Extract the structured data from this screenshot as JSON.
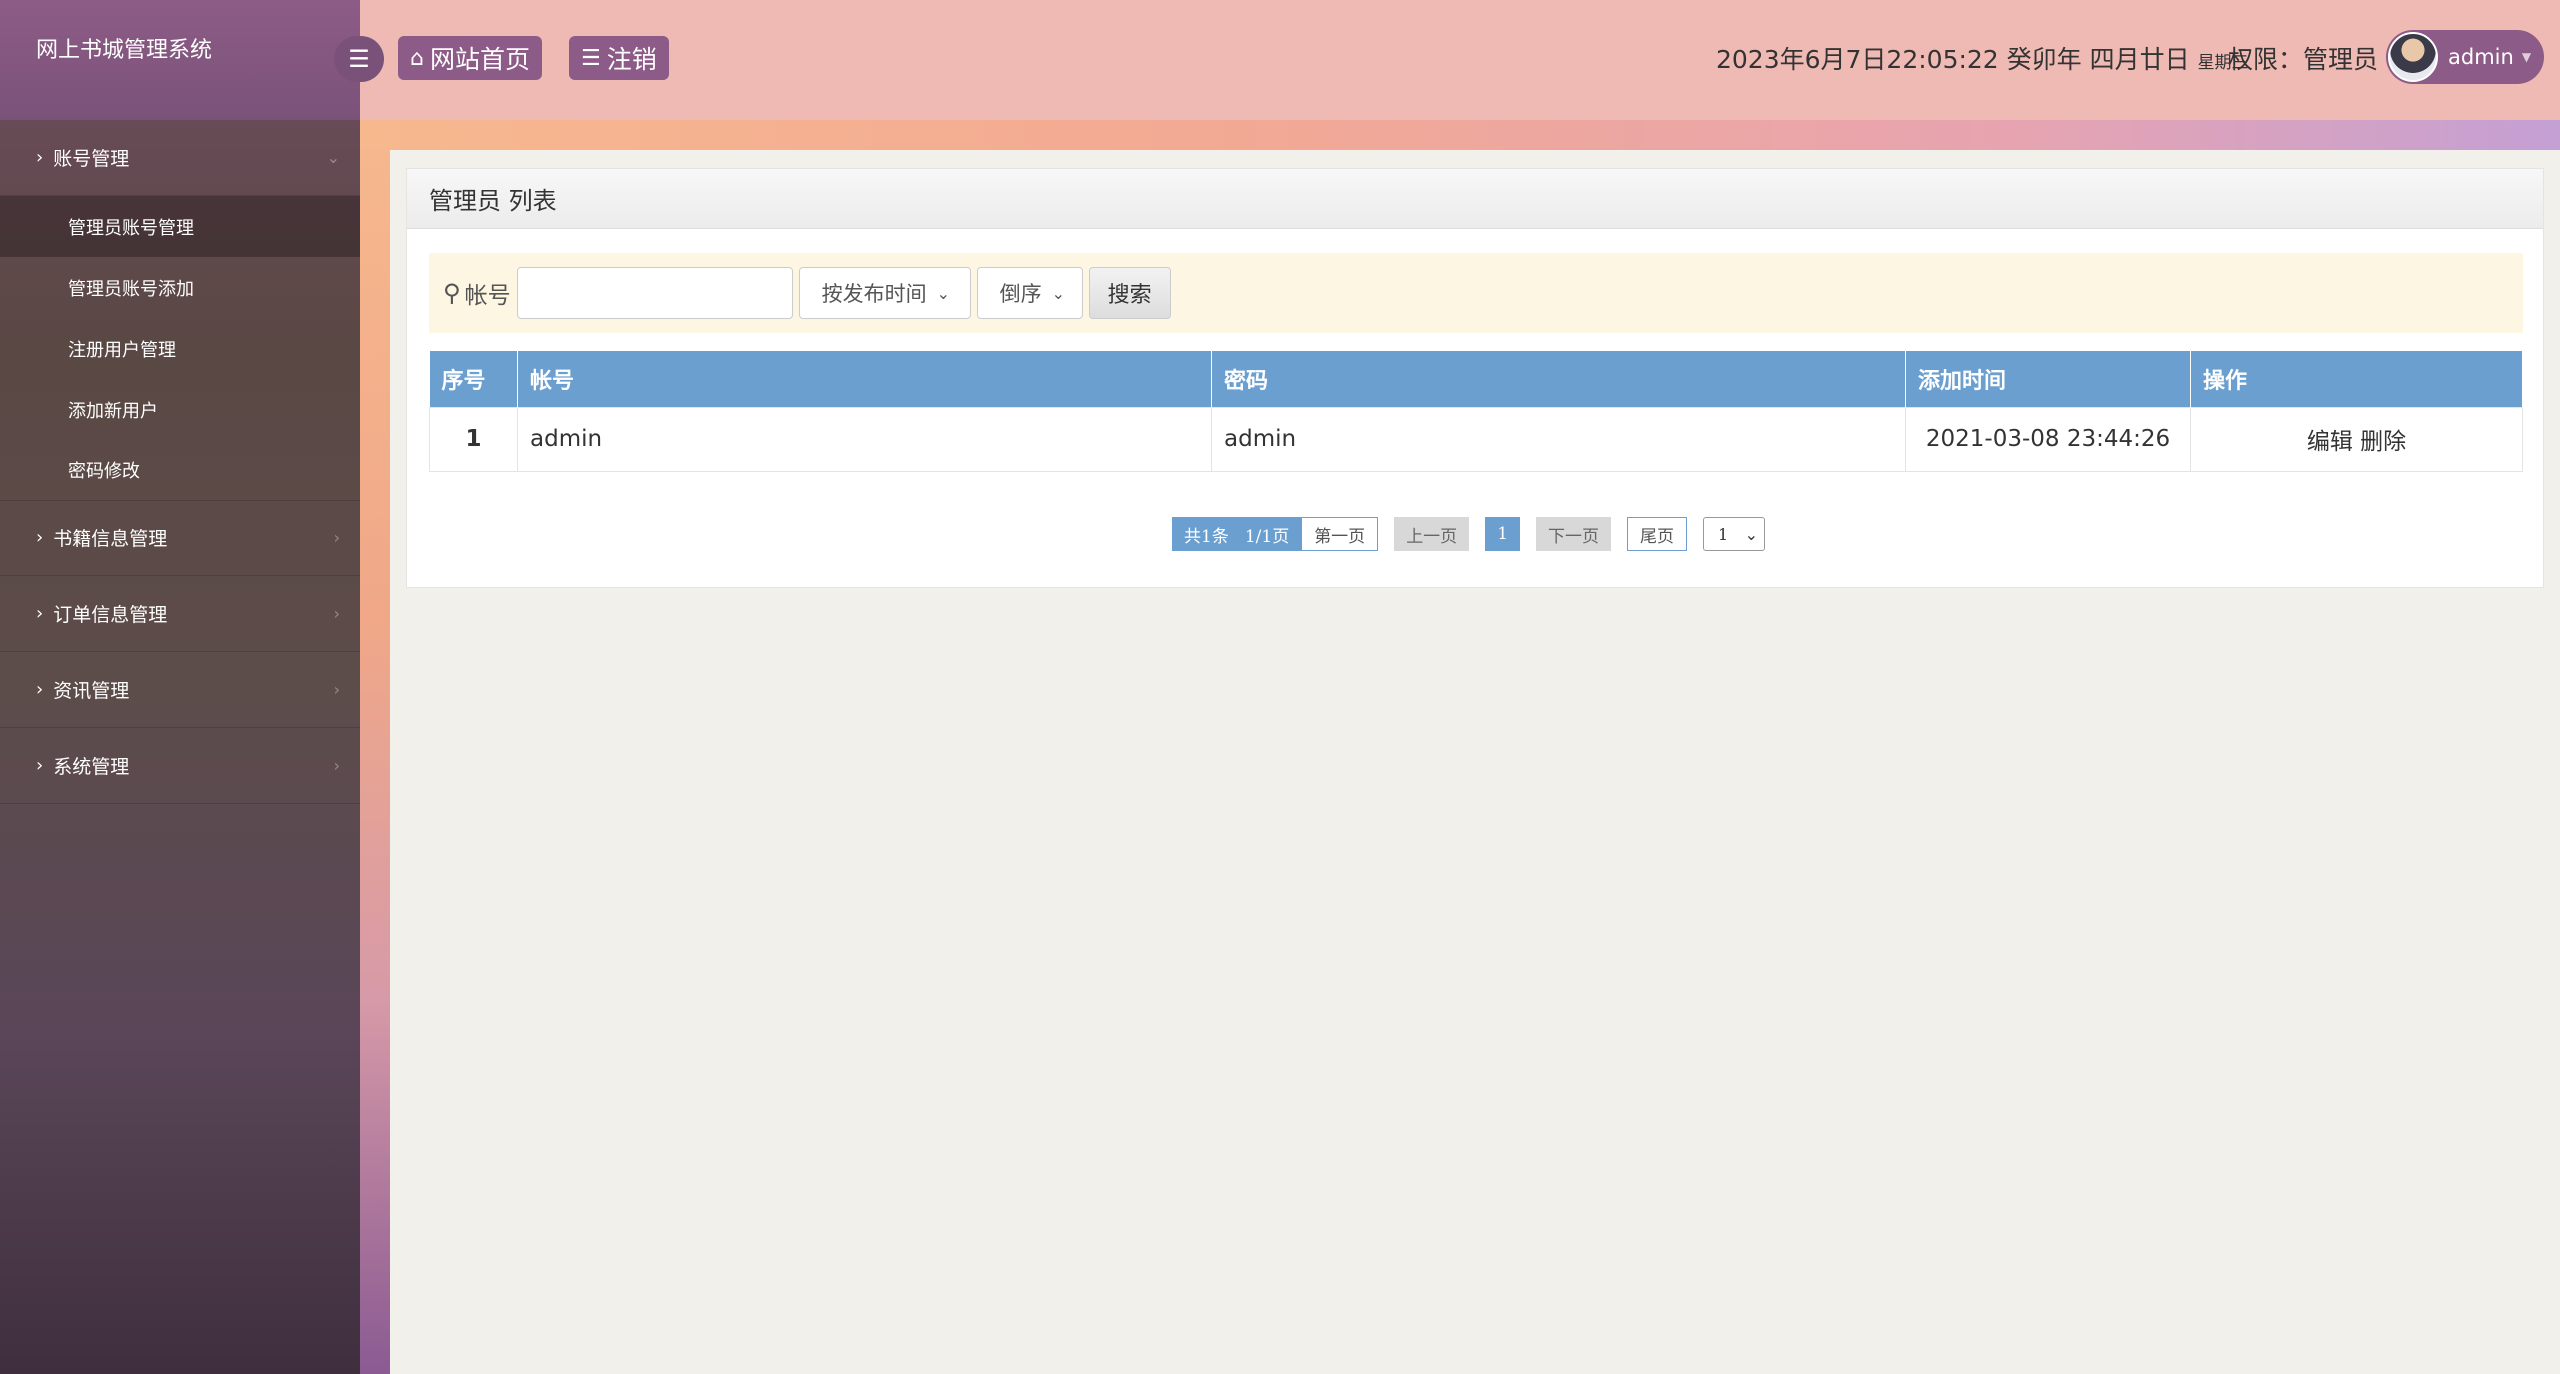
{
  "app": {
    "title": "网上书城管理系统"
  },
  "topbar": {
    "home_label": "网站首页",
    "logout_label": "注销",
    "datetime": "2023年6月7日22:05:22 癸卯年 四月廿日",
    "weekday": "星期三",
    "role": "权限：管理员",
    "username": "admin"
  },
  "sidebar": {
    "groups": [
      {
        "label": "账号管理",
        "expanded": true,
        "items": [
          {
            "label": "管理员账号管理",
            "active": true
          },
          {
            "label": "管理员账号添加"
          },
          {
            "label": "注册用户管理"
          },
          {
            "label": "添加新用户"
          },
          {
            "label": "密码修改"
          }
        ]
      },
      {
        "label": "书籍信息管理"
      },
      {
        "label": "订单信息管理"
      },
      {
        "label": "资讯管理"
      },
      {
        "label": "系统管理"
      }
    ]
  },
  "panel": {
    "title": "管理员 列表",
    "search": {
      "field_label": "帐号",
      "field_value": "",
      "sort_select": "按发布时间",
      "order_select": "倒序",
      "button": "搜索"
    },
    "table": {
      "headers": [
        "序号",
        "帐号",
        "密码",
        "添加时间",
        "操作"
      ],
      "rows": [
        {
          "index": "1",
          "account": "admin",
          "password": "admin",
          "time": "2021-03-08 23:44:26",
          "edit": "编辑",
          "delete": "删除"
        }
      ]
    },
    "pagination": {
      "total": "共1条",
      "pages": "1/1页",
      "first": "第一页",
      "prev": "上一页",
      "current": "1",
      "next": "下一页",
      "last": "尾页",
      "jump": "1"
    }
  },
  "colors": {
    "sidebar": "#5c4c4a",
    "brand": "#8d5c86",
    "topbar": "#efbab4",
    "accent": "#6a9fd0"
  }
}
